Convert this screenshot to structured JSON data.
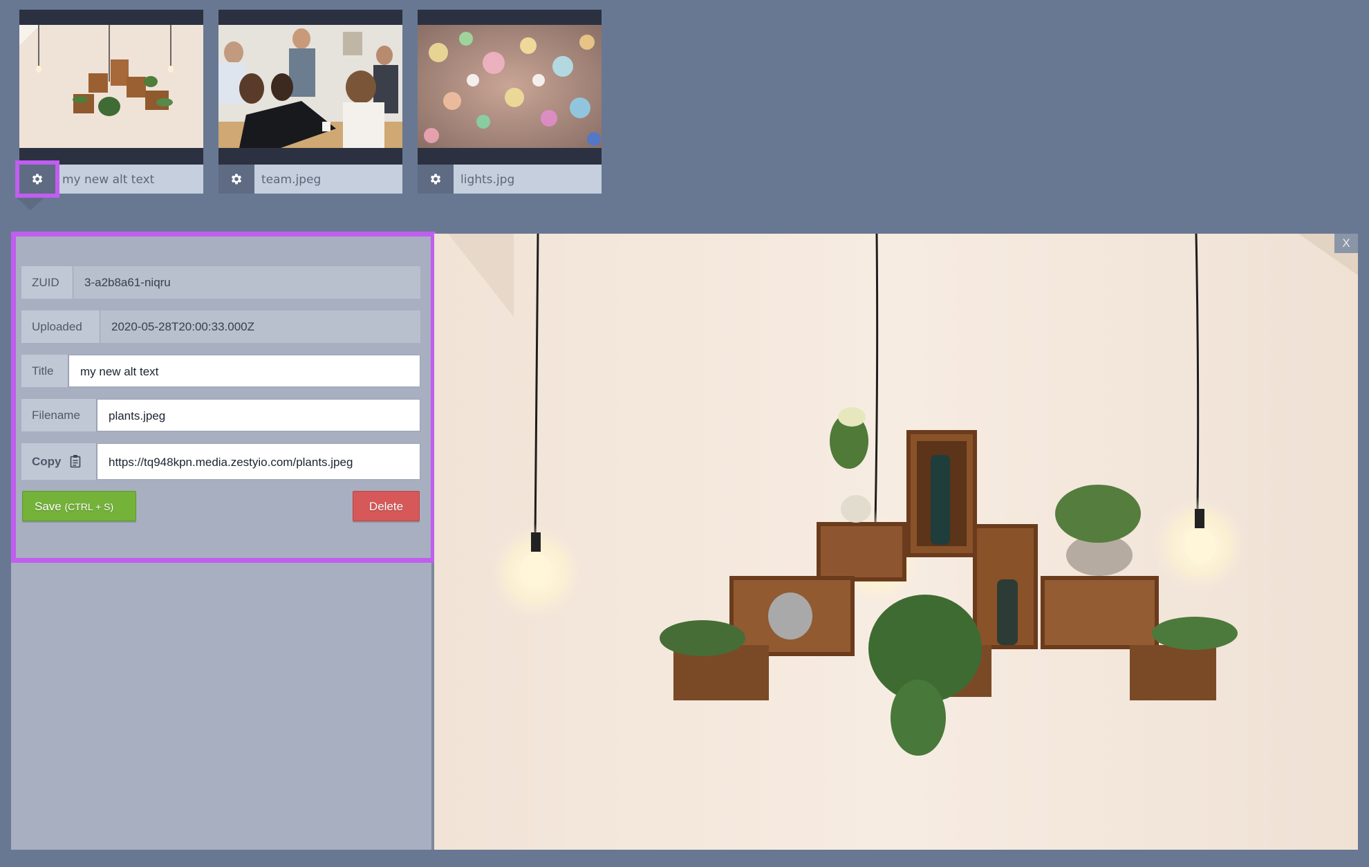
{
  "thumbnails": [
    {
      "name": "my new alt text",
      "selected": true,
      "image": "plants"
    },
    {
      "name": "team.jpeg",
      "selected": false,
      "image": "team"
    },
    {
      "name": "lights.jpg",
      "selected": false,
      "image": "lights"
    }
  ],
  "icons": {
    "thumbnail_settings": "gear-icon",
    "copy": "clipboard-icon"
  },
  "details": {
    "zuid_label": "ZUID",
    "zuid_value": "3-a2b8a61-niqru",
    "uploaded_label": "Uploaded",
    "uploaded_value": "2020-05-28T20:00:33.000Z",
    "title_label": "Title",
    "title_value": "my new alt text",
    "filename_label": "Filename",
    "filename_value": "plants.jpeg",
    "copy_label": "Copy",
    "url_value": "https://tq948kpn.media.zestyio.com/plants.jpeg",
    "save_label": "Save",
    "save_shortcut": "(CTRL + S)",
    "delete_label": "Delete"
  },
  "preview": {
    "close_label": "X"
  },
  "colors": {
    "highlight": "#c05ef0",
    "save": "#74b23a",
    "delete": "#d65858",
    "background": "#687892"
  }
}
